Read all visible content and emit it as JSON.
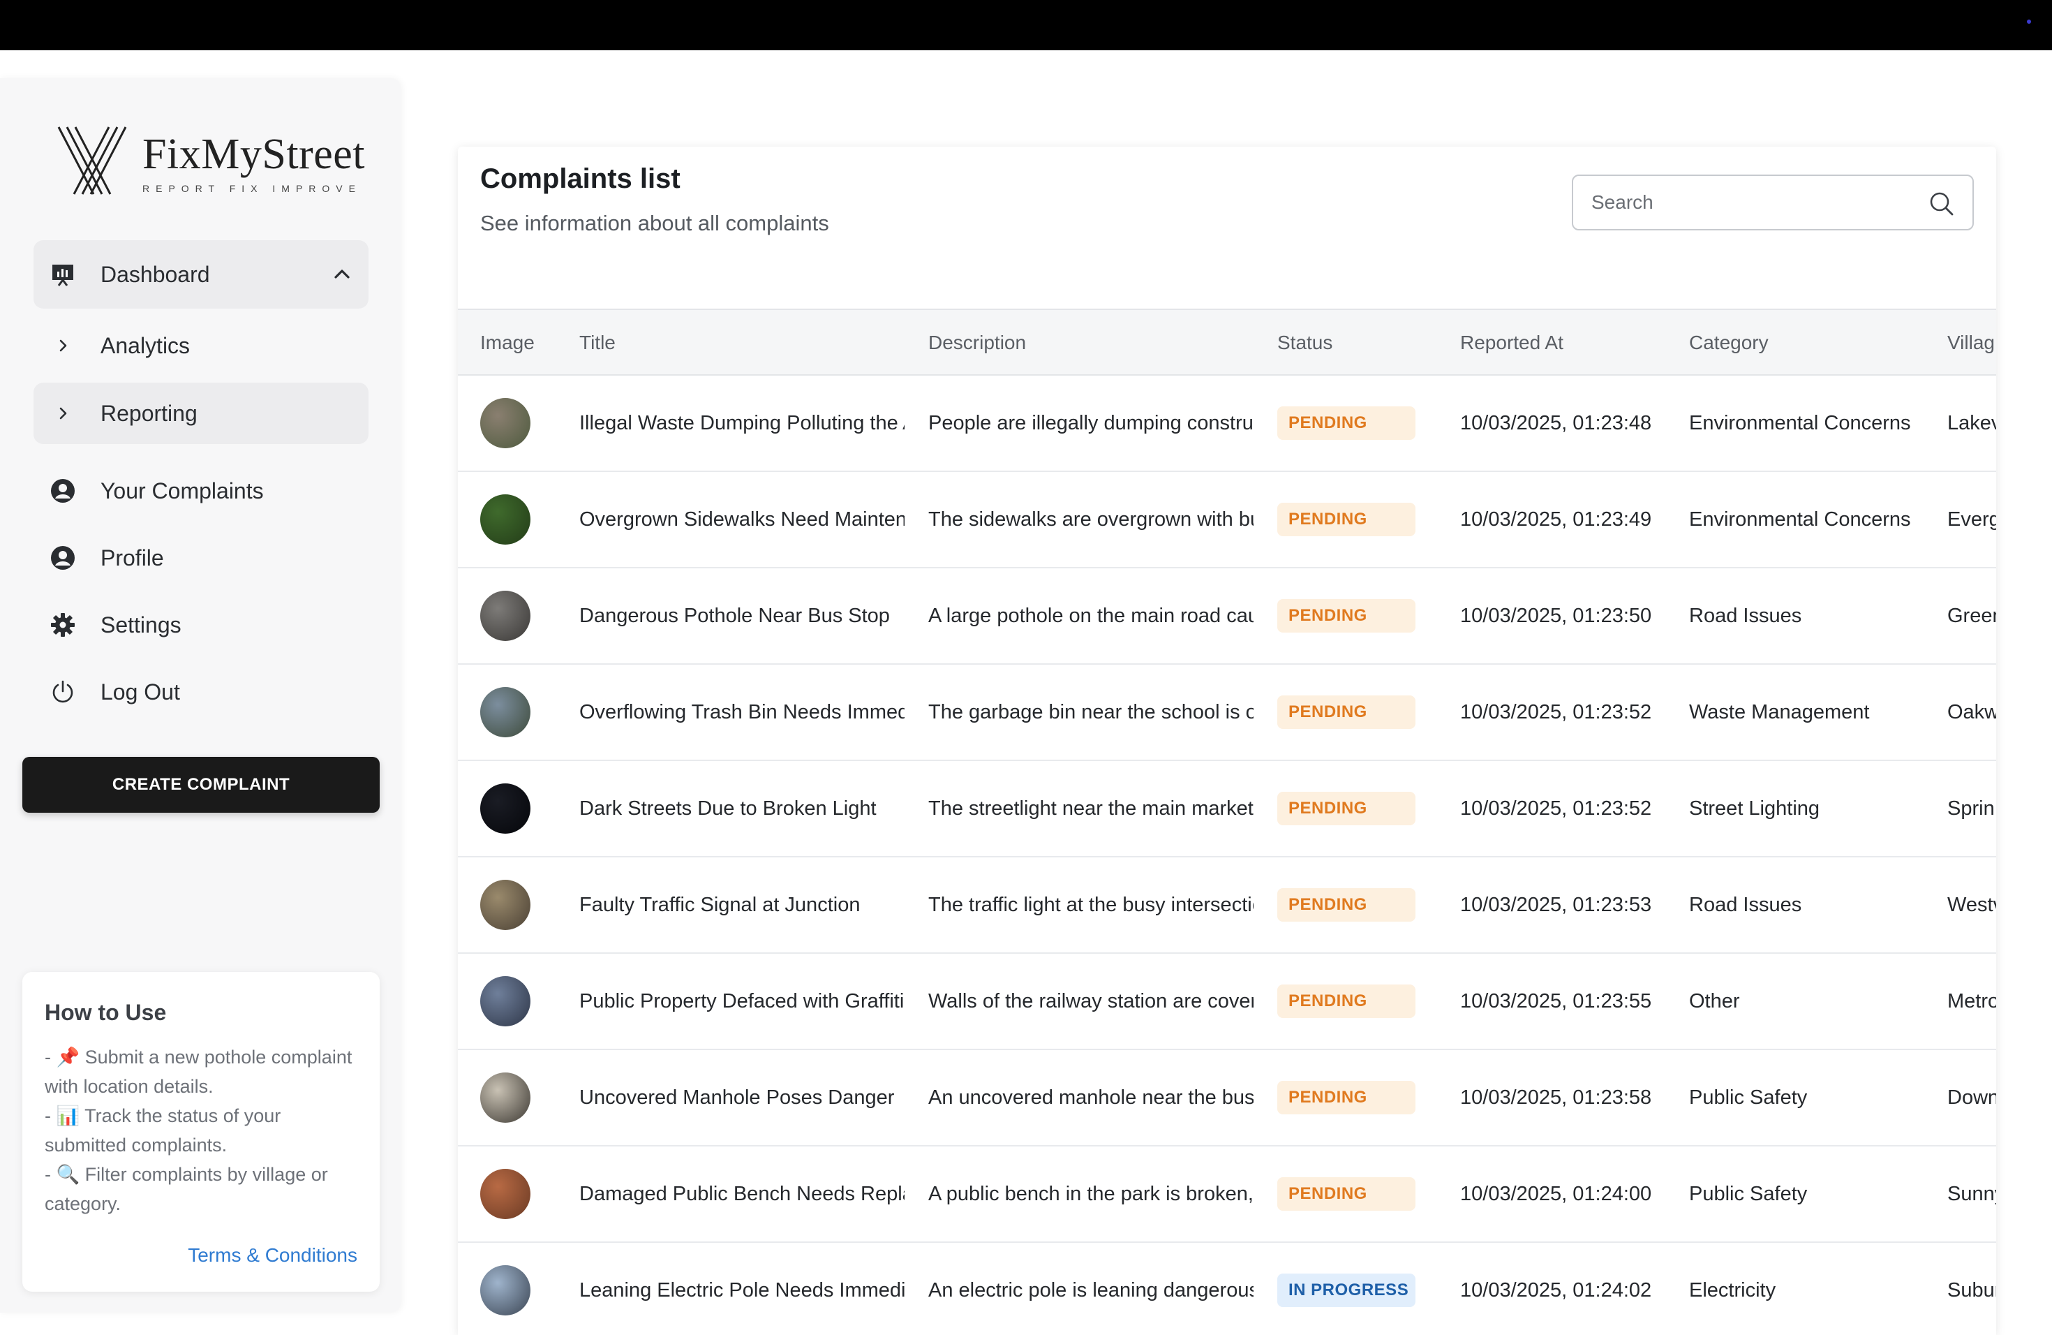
{
  "brand": {
    "name": "FixMyStreet",
    "tagline": "REPORT FIX IMPROVE"
  },
  "nav": {
    "items": [
      {
        "label": "Dashboard",
        "icon": "presentation-chart-icon",
        "active": true
      },
      {
        "label": "Analytics",
        "icon": "chevron-right-icon"
      },
      {
        "label": "Reporting",
        "icon": "chevron-right-icon",
        "active": true
      },
      {
        "label": "Your Complaints",
        "icon": "user-circle-icon"
      },
      {
        "label": "Profile",
        "icon": "user-circle-icon"
      },
      {
        "label": "Settings",
        "icon": "gear-icon"
      },
      {
        "label": "Log Out",
        "icon": "power-icon"
      }
    ],
    "create_button": "CREATE COMPLAINT"
  },
  "howto": {
    "title": "How to Use",
    "line1": "- 📌 Submit a new pothole complaint with location details.",
    "line2": "- 📊 Track the status of your submitted complaints.",
    "line3": "- 🔍 Filter complaints by village or category.",
    "terms": "Terms & Conditions"
  },
  "panel": {
    "title": "Complaints list",
    "subtitle": "See information about all complaints",
    "search_placeholder": "Search"
  },
  "table": {
    "headers": {
      "image": "Image",
      "title": "Title",
      "description": "Description",
      "status": "Status",
      "reported_at": "Reported At",
      "category": "Category",
      "village": "Villag"
    },
    "rows": [
      {
        "thumb": [
          "#8a7f70",
          "#4e5a3e"
        ],
        "title": "Illegal Waste Dumping Polluting the A",
        "description": "People are illegally dumping construct",
        "status": "PENDING",
        "status_type": "pending",
        "reported_at": "10/03/2025, 01:23:48",
        "category": "Environmental Concerns",
        "village": "Lakev"
      },
      {
        "thumb": [
          "#3f6a2c",
          "#233c18"
        ],
        "title": "Overgrown Sidewalks Need Maintena",
        "description": "The sidewalks are overgrown with bus",
        "status": "PENDING",
        "status_type": "pending",
        "reported_at": "10/03/2025, 01:23:49",
        "category": "Environmental Concerns",
        "village": "Everg"
      },
      {
        "thumb": [
          "#7d7b78",
          "#3a3836"
        ],
        "title": "Dangerous Pothole Near Bus Stop",
        "description": "A large pothole on the main road caus",
        "status": "PENDING",
        "status_type": "pending",
        "reported_at": "10/03/2025, 01:23:50",
        "category": "Road Issues",
        "village": "Green"
      },
      {
        "thumb": [
          "#7c8e9e",
          "#3d4a3a"
        ],
        "title": "Overflowing Trash Bin Needs Immedia",
        "description": "The garbage bin near the school is ov",
        "status": "PENDING",
        "status_type": "pending",
        "reported_at": "10/03/2025, 01:23:52",
        "category": "Waste Management",
        "village": "Oakw"
      },
      {
        "thumb": [
          "#1a1c24",
          "#05060a"
        ],
        "title": "Dark Streets Due to Broken Light",
        "description": "The streetlight near the main market h",
        "status": "PENDING",
        "status_type": "pending",
        "reported_at": "10/03/2025, 01:23:52",
        "category": "Street Lighting",
        "village": "Sprin"
      },
      {
        "thumb": [
          "#9a8a6c",
          "#4a4034"
        ],
        "title": "Faulty Traffic Signal at Junction",
        "description": "The traffic light at the busy intersectio",
        "status": "PENDING",
        "status_type": "pending",
        "reported_at": "10/03/2025, 01:23:53",
        "category": "Road Issues",
        "village": "Westv"
      },
      {
        "thumb": [
          "#6f7f9a",
          "#2e3648"
        ],
        "title": "Public Property Defaced with Graffiti",
        "description": "Walls of the railway station are covere",
        "status": "PENDING",
        "status_type": "pending",
        "reported_at": "10/03/2025, 01:23:55",
        "category": "Other",
        "village": "Metro"
      },
      {
        "thumb": [
          "#c9c2b4",
          "#3c3832"
        ],
        "title": "Uncovered Manhole Poses Danger",
        "description": "An uncovered manhole near the bus s",
        "status": "PENDING",
        "status_type": "pending",
        "reported_at": "10/03/2025, 01:23:58",
        "category": "Public Safety",
        "village": "Down"
      },
      {
        "thumb": [
          "#b86a44",
          "#6a3a24"
        ],
        "title": "Damaged Public Bench Needs Replac",
        "description": "A public bench in the park is broken, r",
        "status": "PENDING",
        "status_type": "pending",
        "reported_at": "10/03/2025, 01:24:00",
        "category": "Public Safety",
        "village": "Sunny"
      },
      {
        "thumb": [
          "#9fb4cc",
          "#3a4452"
        ],
        "title": "Leaning Electric Pole Needs Immedia",
        "description": "An electric pole is leaning dangerously",
        "status": "IN PROGRESS",
        "status_type": "progress",
        "reported_at": "10/03/2025, 01:24:02",
        "category": "Electricity",
        "village": "Subur"
      }
    ]
  }
}
